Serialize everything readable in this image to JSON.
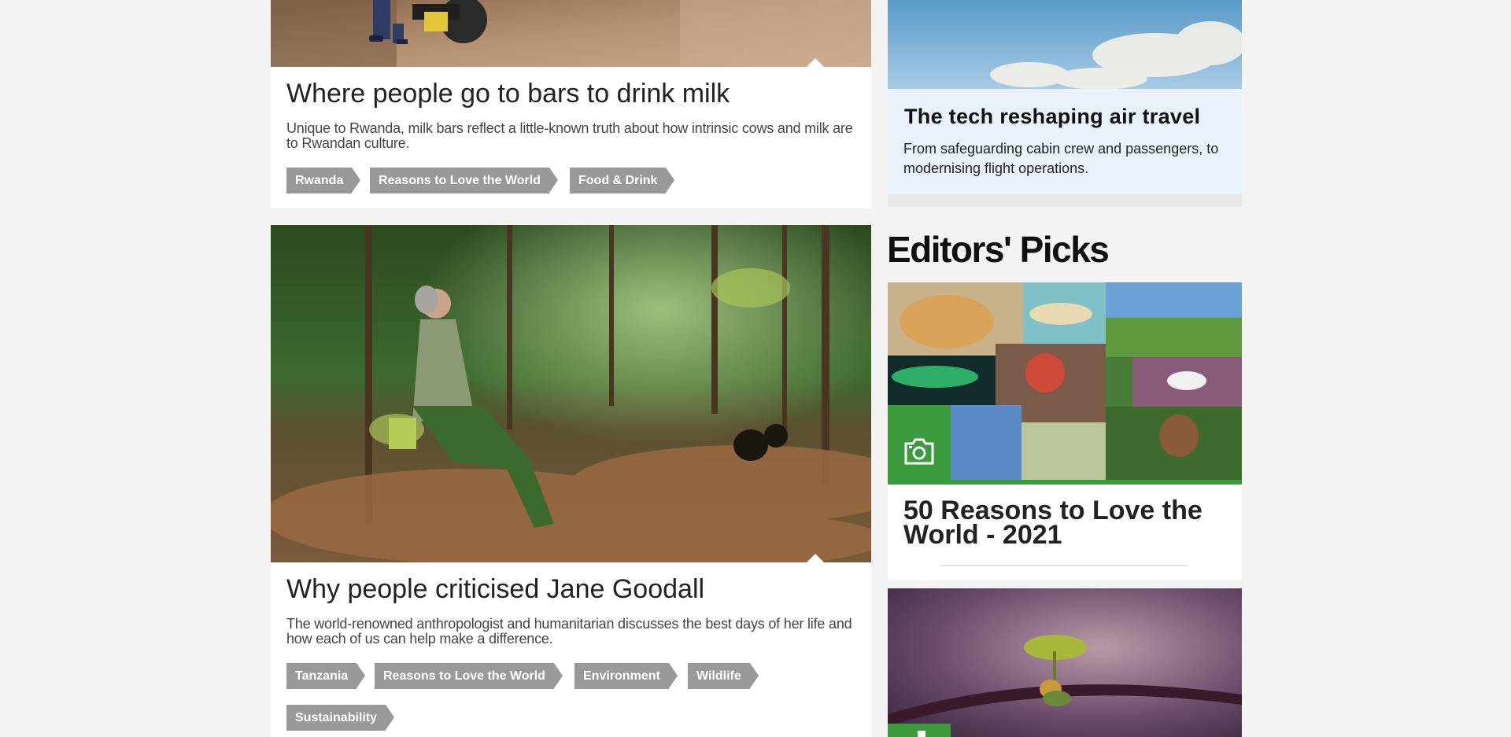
{
  "articles": [
    {
      "title": "Where people go to bars to drink milk",
      "description": "Unique to Rwanda, milk bars reflect a little-known truth about how intrinsic cows and milk are to Rwandan culture.",
      "tags": [
        "Rwanda",
        "Reasons to Love the World",
        "Food & Drink"
      ]
    },
    {
      "title": "Why people criticised Jane Goodall",
      "description": "The world-renowned anthropologist and humanitarian discusses the best days of her life and how each of us can help make a difference.",
      "tags": [
        "Tanzania",
        "Reasons to Love the World",
        "Environment",
        "Wildlife",
        "Sustainability"
      ]
    }
  ],
  "sidebar": {
    "promo": {
      "title": "The tech reshaping air travel",
      "description": "From safeguarding cabin crew and passengers, to modernising flight operations."
    },
    "editors_picks_heading": "Editors' Picks",
    "picks": [
      {
        "title": "50 Reasons to Love the World - 2021",
        "icon": "camera-icon"
      },
      {
        "title": "",
        "icon": "camera-icon"
      }
    ]
  },
  "colors": {
    "tag_bg": "#999999",
    "badge_green": "#3b9a3c",
    "promo_bg": "#e9f2fb"
  }
}
